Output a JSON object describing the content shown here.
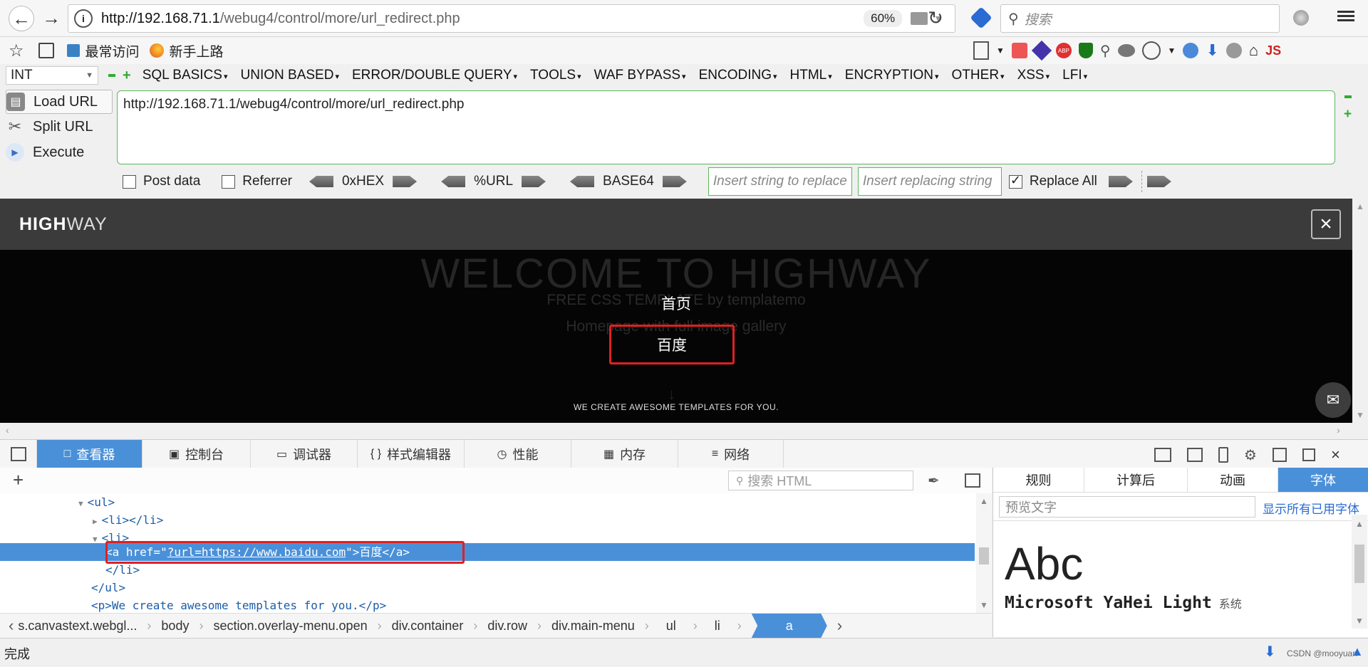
{
  "nav": {
    "url_host": "http://192.168.71.1",
    "url_path": "/webug4/control/more/url_redirect.php",
    "zoom": "60%",
    "search_placeholder": "搜索"
  },
  "bookmarks": [
    {
      "label": "最常访问"
    },
    {
      "label": "新手上路"
    }
  ],
  "hackbar": {
    "select_value": "INT",
    "menus": [
      "SQL BASICS",
      "UNION BASED",
      "ERROR/DOUBLE QUERY",
      "TOOLS",
      "WAF BYPASS",
      "ENCODING",
      "HTML",
      "ENCRYPTION",
      "OTHER",
      "XSS",
      "LFI"
    ],
    "load_url": "Load URL",
    "split_url": "Split URL",
    "execute": "Execute",
    "url_value": "http://192.168.71.1/webug4/control/more/url_redirect.php",
    "post_data": "Post data",
    "referrer": "Referrer",
    "hex": "0xHEX",
    "urlenc": "%URL",
    "base64": "BASE64",
    "replace_placeholder": "Insert string to replace",
    "replacing_placeholder": "Insert replacing string",
    "replace_all": "Replace All",
    "replace_all_checked": true
  },
  "site": {
    "brand_bold": "HIGH",
    "brand_light": "WAY",
    "bg_title": "WELCOME TO HIGHWAY",
    "bg_sub1": "FREE CSS TEMPLATE by templatemo",
    "bg_sub2": "Homepage with full image gallery",
    "menu_home": "首页",
    "menu_baidu": "百度",
    "tagline": "WE CREATE AWESOME TEMPLATES FOR YOU."
  },
  "devtools": {
    "tabs": [
      {
        "label": "查看器",
        "icon": "inspector-icon"
      },
      {
        "label": "控制台",
        "icon": "console-icon"
      },
      {
        "label": "调试器",
        "icon": "debugger-icon"
      },
      {
        "label": "样式编辑器",
        "icon": "style-editor-icon"
      },
      {
        "label": "性能",
        "icon": "performance-icon"
      },
      {
        "label": "内存",
        "icon": "memory-icon"
      },
      {
        "label": "网络",
        "icon": "network-icon"
      }
    ],
    "search_html_placeholder": "搜索 HTML",
    "markup": {
      "ul_open": "<ul>",
      "li_empty": "<li></li>",
      "li_open": "<li>",
      "a_prefix": "<a href=\"",
      "a_href": "?url=https://www.baidu.com",
      "a_suffix": "\">百度</a>",
      "li_close": "</li>",
      "ul_close": "</ul>",
      "p_line": "<p>We create awesome templates for you.</p>"
    },
    "breadcrumbs": [
      "s.canvastext.webgl...",
      "body",
      "section.overlay-menu.open",
      "div.container",
      "div.row",
      "div.main-menu",
      "ul",
      "li",
      "a"
    ],
    "side_tabs": [
      "规则",
      "计算后",
      "动画",
      "字体"
    ],
    "preview_placeholder": "预览文字",
    "show_all_fonts": "显示所有已用字体",
    "font_preview": "Abc",
    "font_name": "Microsoft YaHei Light",
    "font_source": "系统"
  },
  "status": {
    "text": "完成",
    "watermark": "CSDN @mooyuan"
  },
  "colors": {
    "accent": "#4a90d9",
    "highlight_box": "#e02020",
    "hackbar_green": "#5db65d"
  }
}
